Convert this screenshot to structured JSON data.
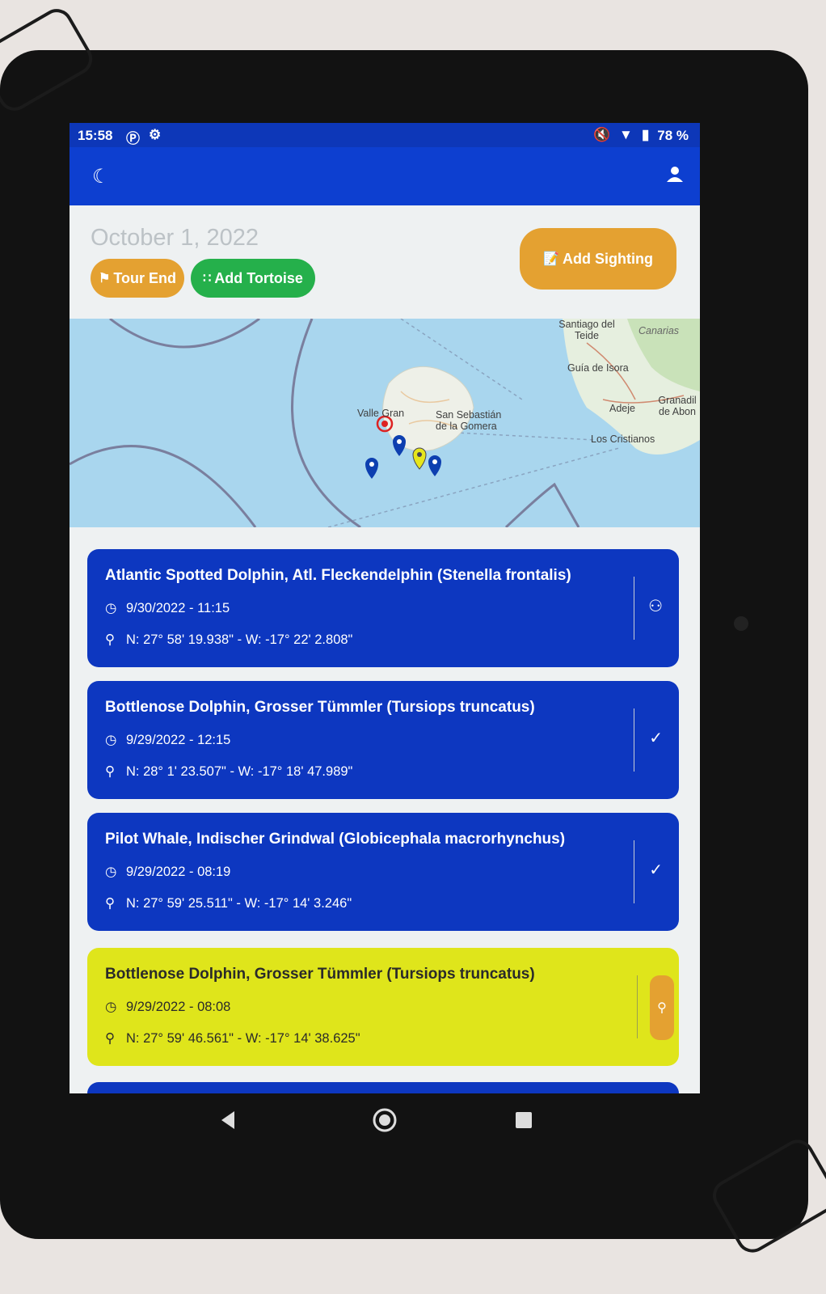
{
  "status_bar": {
    "time": "15:58",
    "battery": "78 %"
  },
  "header": {
    "date": "October 1, 2022",
    "tour_end_label": "Tour End",
    "add_tortoise_label": "Add Tortoise",
    "add_sighting_label": "Add Sighting"
  },
  "map": {
    "labels": {
      "valle_gran": "Valle Gran",
      "san_sebastian": "San Sebastián de la Gomera",
      "santiago": "Santiago del Teide",
      "canarias": "Canarias",
      "guia": "Guía de Isora",
      "adeje": "Adeje",
      "granadilla": "Granadil de Abon",
      "los_cristianos": "Los Cristianos"
    }
  },
  "sightings": [
    {
      "title": "Atlantic Spotted Dolphin, Atl. Fleckendelphin (Stenella frontalis)",
      "datetime": "9/30/2022 - 11:15",
      "coords": "N: 27° 58' 19.938\" - W: -17° 22' 2.808\"",
      "action_icon": "group-icon"
    },
    {
      "title": "Bottlenose Dolphin, Grosser Tümmler (Tursiops truncatus)",
      "datetime": "9/29/2022 - 12:15",
      "coords": "N: 28° 1' 23.507\" - W: -17° 18' 47.989\"",
      "action_icon": "check-icon"
    },
    {
      "title": "Pilot Whale, Indischer Grindwal (Globicephala macrorhynchus)",
      "datetime": "9/29/2022 - 08:19",
      "coords": "N: 27° 59' 25.511\" - W: -17° 14' 3.246\"",
      "action_icon": "check-icon"
    },
    {
      "title": "Bottlenose Dolphin, Grosser Tümmler (Tursiops truncatus)",
      "datetime": "9/29/2022 - 08:08",
      "coords": "N: 27° 59' 46.561\" - W: -17° 14' 38.625\"",
      "action_icon": "add-location-icon"
    }
  ],
  "colors": {
    "primary": "#0d3fd0",
    "accent": "#e4a131",
    "success": "#25b04b",
    "highlight": "#dfe51b"
  }
}
